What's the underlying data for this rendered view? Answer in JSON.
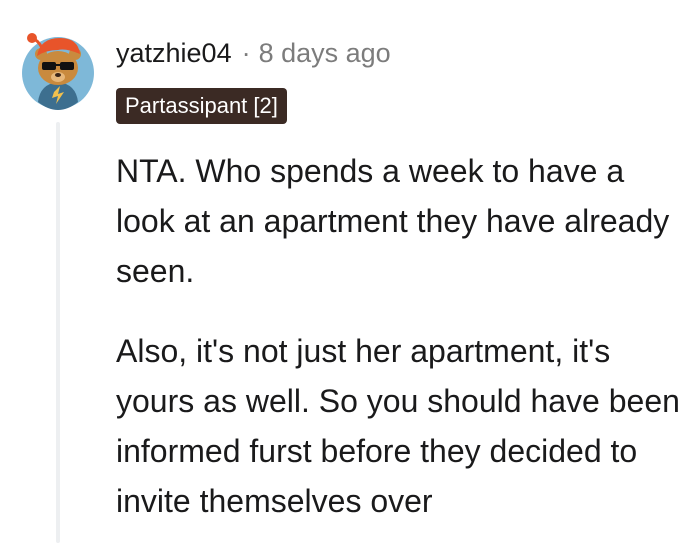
{
  "comment": {
    "author": {
      "username": "yatzhie04",
      "avatar_icon": "snoo-avatar-icon"
    },
    "separator": "·",
    "timestamp": "8 days ago",
    "flair": "Partassipant [2]",
    "paragraphs": [
      "NTA. Who spends a week to have a look at an apartment they have already seen.",
      "Also, it's not just her apartment, it's yours as well. So you should have been informed furst before they decided to invite themselves over"
    ]
  },
  "colors": {
    "flair_bg": "#3b2a24",
    "meta_text": "#7c7c7c",
    "thread_line": "#edeff1",
    "avatar_ring": "#7eb8d8",
    "avatar_bear": "#c98a3e",
    "avatar_hat": "#e8542a"
  }
}
